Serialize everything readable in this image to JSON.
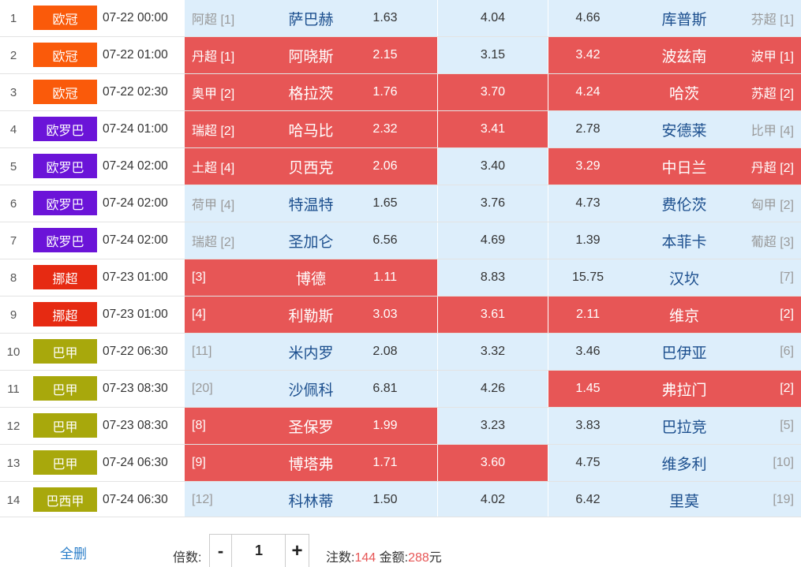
{
  "colors": {
    "ucl": "#fa5a0a",
    "uel": "#6b14d8",
    "eliteserien": "#e62a12",
    "brasileirao_a": "#a8a80c",
    "selected": "#e75656",
    "unselected": "#ddeefb"
  },
  "matches": [
    {
      "num": "1",
      "league": "欧冠",
      "league_color": "#fa5a0a",
      "time": "07-22 00:00",
      "home_rank": "阿超 [1]",
      "home": "萨巴赫",
      "home_odds": "1.63",
      "draw_odds": "4.04",
      "away_odds": "4.66",
      "away": "库普斯",
      "away_rank": "芬超 [1]",
      "sel": [
        false,
        false,
        false
      ]
    },
    {
      "num": "2",
      "league": "欧冠",
      "league_color": "#fa5a0a",
      "time": "07-22 01:00",
      "home_rank": "丹超 [1]",
      "home": "阿晓斯",
      "home_odds": "2.15",
      "draw_odds": "3.15",
      "away_odds": "3.42",
      "away": "波兹南",
      "away_rank": "波甲 [1]",
      "sel": [
        true,
        false,
        true
      ]
    },
    {
      "num": "3",
      "league": "欧冠",
      "league_color": "#fa5a0a",
      "time": "07-22 02:30",
      "home_rank": "奥甲 [2]",
      "home": "格拉茨",
      "home_odds": "1.76",
      "draw_odds": "3.70",
      "away_odds": "4.24",
      "away": "哈茨",
      "away_rank": "苏超 [2]",
      "sel": [
        true,
        true,
        true
      ]
    },
    {
      "num": "4",
      "league": "欧罗巴",
      "league_color": "#6b14d8",
      "time": "07-24 01:00",
      "home_rank": "瑞超 [2]",
      "home": "哈马比",
      "home_odds": "2.32",
      "draw_odds": "3.41",
      "away_odds": "2.78",
      "away": "安德莱",
      "away_rank": "比甲 [4]",
      "sel": [
        true,
        true,
        false
      ]
    },
    {
      "num": "5",
      "league": "欧罗巴",
      "league_color": "#6b14d8",
      "time": "07-24 02:00",
      "home_rank": "土超 [4]",
      "home": "贝西克",
      "home_odds": "2.06",
      "draw_odds": "3.40",
      "away_odds": "3.29",
      "away": "中日兰",
      "away_rank": "丹超 [2]",
      "sel": [
        true,
        false,
        true
      ]
    },
    {
      "num": "6",
      "league": "欧罗巴",
      "league_color": "#6b14d8",
      "time": "07-24 02:00",
      "home_rank": "荷甲 [4]",
      "home": "特温特",
      "home_odds": "1.65",
      "draw_odds": "3.76",
      "away_odds": "4.73",
      "away": "费伦茨",
      "away_rank": "匈甲 [2]",
      "sel": [
        false,
        false,
        false
      ]
    },
    {
      "num": "7",
      "league": "欧罗巴",
      "league_color": "#6b14d8",
      "time": "07-24 02:00",
      "home_rank": "瑞超 [2]",
      "home": "圣加仑",
      "home_odds": "6.56",
      "draw_odds": "4.69",
      "away_odds": "1.39",
      "away": "本菲卡",
      "away_rank": "葡超 [3]",
      "sel": [
        false,
        false,
        false
      ]
    },
    {
      "num": "8",
      "league": "挪超",
      "league_color": "#e62a12",
      "time": "07-23 01:00",
      "home_rank": "[3]",
      "home": "博德",
      "home_odds": "1.11",
      "draw_odds": "8.83",
      "away_odds": "15.75",
      "away": "汉坎",
      "away_rank": "[7]",
      "sel": [
        true,
        false,
        false
      ]
    },
    {
      "num": "9",
      "league": "挪超",
      "league_color": "#e62a12",
      "time": "07-23 01:00",
      "home_rank": "[4]",
      "home": "利勒斯",
      "home_odds": "3.03",
      "draw_odds": "3.61",
      "away_odds": "2.11",
      "away": "维京",
      "away_rank": "[2]",
      "sel": [
        true,
        true,
        true
      ]
    },
    {
      "num": "10",
      "league": "巴甲",
      "league_color": "#a8a80c",
      "time": "07-22 06:30",
      "home_rank": "[11]",
      "home": "米内罗",
      "home_odds": "2.08",
      "draw_odds": "3.32",
      "away_odds": "3.46",
      "away": "巴伊亚",
      "away_rank": "[6]",
      "sel": [
        false,
        false,
        false
      ]
    },
    {
      "num": "11",
      "league": "巴甲",
      "league_color": "#a8a80c",
      "time": "07-23 08:30",
      "home_rank": "[20]",
      "home": "沙佩科",
      "home_odds": "6.81",
      "draw_odds": "4.26",
      "away_odds": "1.45",
      "away": "弗拉门",
      "away_rank": "[2]",
      "sel": [
        false,
        false,
        true
      ]
    },
    {
      "num": "12",
      "league": "巴甲",
      "league_color": "#a8a80c",
      "time": "07-23 08:30",
      "home_rank": "[8]",
      "home": "圣保罗",
      "home_odds": "1.99",
      "draw_odds": "3.23",
      "away_odds": "3.83",
      "away": "巴拉竞",
      "away_rank": "[5]",
      "sel": [
        true,
        false,
        false
      ]
    },
    {
      "num": "13",
      "league": "巴甲",
      "league_color": "#a8a80c",
      "time": "07-24 06:30",
      "home_rank": "[9]",
      "home": "博塔弗",
      "home_odds": "1.71",
      "draw_odds": "3.60",
      "away_odds": "4.75",
      "away": "维多利",
      "away_rank": "[10]",
      "sel": [
        true,
        true,
        false
      ]
    },
    {
      "num": "14",
      "league": "巴西甲",
      "league_color": "#a8a80c",
      "time": "07-24 06:30",
      "home_rank": "[12]",
      "home": "科林蒂",
      "home_odds": "1.50",
      "draw_odds": "4.02",
      "away_odds": "6.42",
      "away": "里莫",
      "away_rank": "[19]",
      "sel": [
        false,
        false,
        false
      ]
    }
  ],
  "footer": {
    "clear_all": "全删",
    "multiplier_label": "倍数:",
    "minus": "-",
    "plus": "+",
    "multiplier_value": "1",
    "bets_label": "注数:",
    "bets_value": "144",
    "amount_label": "金额:",
    "amount_value": "288",
    "amount_unit": "元"
  }
}
